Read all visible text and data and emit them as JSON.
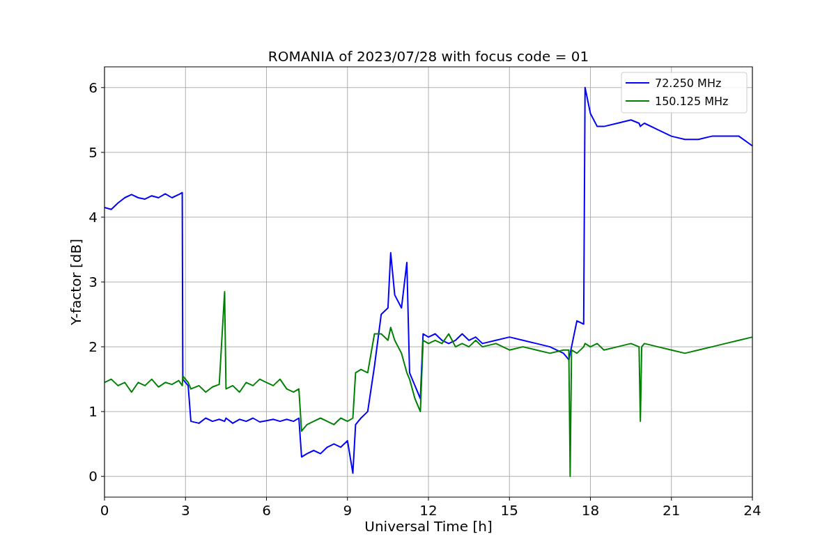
{
  "chart_data": {
    "type": "line",
    "title": "ROMANIA of 2023/07/28 with focus code = 01",
    "xlabel": "Universal Time [h]",
    "ylabel": "Y-factor [dB]",
    "x": [
      0,
      0.25,
      0.5,
      0.75,
      1,
      1.25,
      1.5,
      1.75,
      2,
      2.25,
      2.5,
      2.75,
      2.88,
      2.9,
      3.1,
      3.2,
      3.5,
      3.75,
      4,
      4.25,
      4.45,
      4.5,
      4.75,
      5,
      5.25,
      5.5,
      5.75,
      6,
      6.25,
      6.5,
      6.75,
      7,
      7.2,
      7.3,
      7.5,
      7.75,
      8,
      8.25,
      8.5,
      8.75,
      9,
      9.2,
      9.3,
      9.5,
      9.75,
      10,
      10.25,
      10.5,
      10.6,
      10.75,
      11,
      11.2,
      11.3,
      11.5,
      11.7,
      11.8,
      12,
      12.25,
      12.5,
      12.75,
      13,
      13.25,
      13.5,
      13.75,
      14,
      14.5,
      15,
      15.5,
      16,
      16.5,
      17,
      17.2,
      17.25,
      17.3,
      17.5,
      17.75,
      17.8,
      18,
      18.25,
      18.5,
      19,
      19.5,
      19.8,
      19.85,
      19.9,
      20,
      20.5,
      21,
      21.5,
      22,
      22.5,
      23,
      23.5,
      24
    ],
    "series": [
      {
        "name": "72.250 MHz",
        "color": "#0000ff",
        "values": [
          4.15,
          4.12,
          4.22,
          4.3,
          4.35,
          4.3,
          4.28,
          4.33,
          4.3,
          4.36,
          4.3,
          4.35,
          4.38,
          1.5,
          1.4,
          0.85,
          0.82,
          0.9,
          0.85,
          0.88,
          0.85,
          0.9,
          0.82,
          0.88,
          0.85,
          0.9,
          0.84,
          0.86,
          0.88,
          0.85,
          0.88,
          0.85,
          0.9,
          0.3,
          0.35,
          0.4,
          0.35,
          0.45,
          0.5,
          0.45,
          0.55,
          0.05,
          0.8,
          0.9,
          1.0,
          1.7,
          2.5,
          2.6,
          3.45,
          2.8,
          2.6,
          3.3,
          1.6,
          1.4,
          1.2,
          2.2,
          2.15,
          2.2,
          2.1,
          2.05,
          2.1,
          2.2,
          2.1,
          2.15,
          2.05,
          2.1,
          2.15,
          2.1,
          2.05,
          2.0,
          1.9,
          1.8,
          1.9,
          2.0,
          2.4,
          2.35,
          6.0,
          5.6,
          5.4,
          5.4,
          5.45,
          5.5,
          5.45,
          5.4,
          5.42,
          5.45,
          5.35,
          5.25,
          5.2,
          5.2,
          5.25,
          5.25,
          5.25,
          5.1
        ]
      },
      {
        "name": "150.125 MHz",
        "color": "#008000",
        "values": [
          1.45,
          1.5,
          1.4,
          1.45,
          1.3,
          1.45,
          1.4,
          1.5,
          1.38,
          1.45,
          1.42,
          1.48,
          1.4,
          1.55,
          1.45,
          1.35,
          1.4,
          1.3,
          1.38,
          1.42,
          2.85,
          1.35,
          1.4,
          1.3,
          1.45,
          1.4,
          1.5,
          1.45,
          1.4,
          1.5,
          1.35,
          1.3,
          1.35,
          0.7,
          0.8,
          0.85,
          0.9,
          0.85,
          0.8,
          0.9,
          0.85,
          0.9,
          1.6,
          1.65,
          1.6,
          2.2,
          2.2,
          2.1,
          2.3,
          2.1,
          1.9,
          1.6,
          1.5,
          1.2,
          1.0,
          2.1,
          2.05,
          2.1,
          2.05,
          2.2,
          2.0,
          2.05,
          2.0,
          2.1,
          2.0,
          2.05,
          1.95,
          2.0,
          1.95,
          1.9,
          1.95,
          1.95,
          0.0,
          1.95,
          1.9,
          2.0,
          2.05,
          2.0,
          2.05,
          1.95,
          2.0,
          2.05,
          2.0,
          0.85,
          2.0,
          2.05,
          2.0,
          1.95,
          1.9,
          1.95,
          2.0,
          2.05,
          2.1,
          2.15
        ]
      }
    ],
    "xlim": [
      0,
      24
    ],
    "ylim": [
      -0.32,
      6.32
    ],
    "xticks": [
      0,
      3,
      6,
      9,
      12,
      15,
      18,
      21,
      24
    ],
    "yticks": [
      0,
      1,
      2,
      3,
      4,
      5,
      6
    ],
    "grid": true,
    "legend": "upper right"
  }
}
